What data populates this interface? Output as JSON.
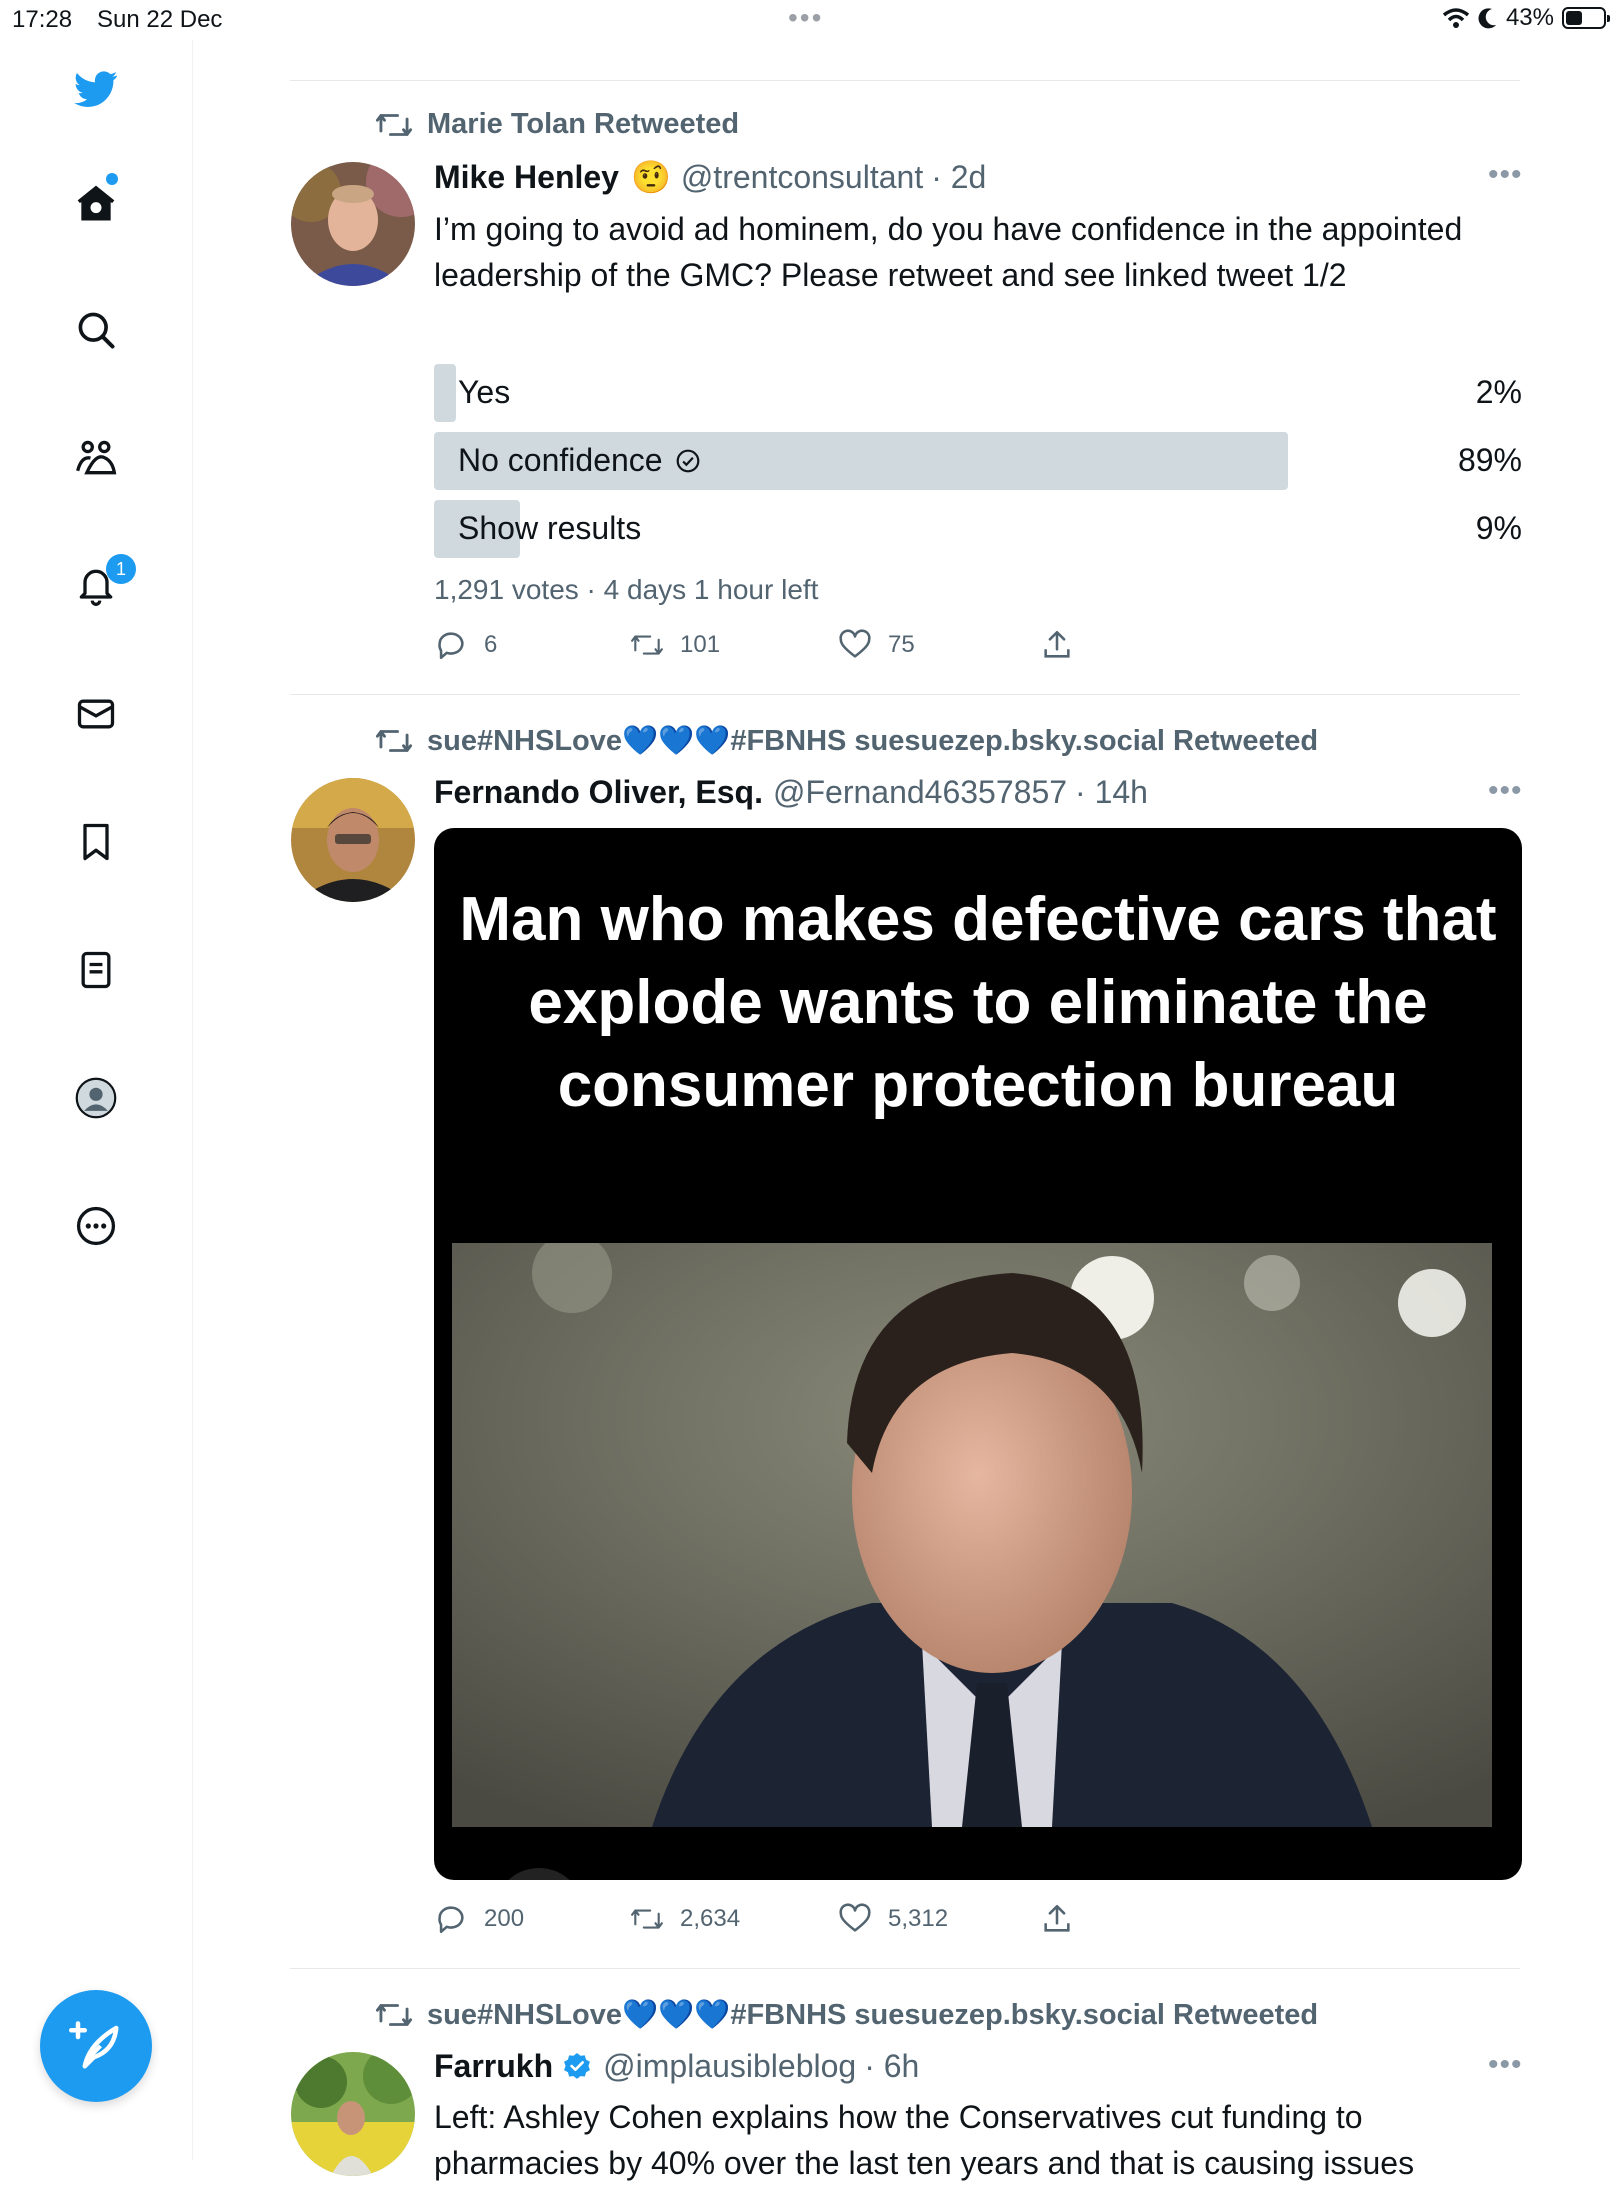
{
  "status_bar": {
    "time": "17:28",
    "date": "Sun 22 Dec",
    "battery": "43%",
    "more": "•••"
  },
  "sidebar": {
    "notifications_badge": "1"
  },
  "tweets": [
    {
      "retweeted_by": "Marie Tolan Retweeted",
      "name": "Mike Henley",
      "emoji": "🤨",
      "handle": "@trentconsultant",
      "time": "· 2d",
      "text": "I’m going to avoid ad hominem, do you have confidence in the appointed leadership of the GMC? Please retweet and see linked tweet 1/2",
      "poll": [
        {
          "label": "Yes",
          "percent": "2%",
          "fraction": 0.02
        },
        {
          "label": "No confidence",
          "percent": "89%",
          "fraction": 0.89,
          "winner": true
        },
        {
          "label": "Show results",
          "percent": "9%",
          "fraction": 0.09
        }
      ],
      "poll_meta": "1,291 votes · 4 days 1 hour left",
      "replies": "6",
      "retweets": "101",
      "likes": "75"
    },
    {
      "retweeted_by": "sue#NHSLove💙💙💙#FBNHS suesuezep.bsky.social Retweeted",
      "name": "Fernando Oliver, Esq.",
      "handle": "@Fernand46357857",
      "time": "· 14h",
      "image_caption": "Man who makes defective cars that explode wants to eliminate the consumer protection bureau",
      "replies": "200",
      "retweets": "2,634",
      "likes": "5,312"
    },
    {
      "retweeted_by": "sue#NHSLove💙💙💙#FBNHS suesuezep.bsky.social Retweeted",
      "name": "Farrukh",
      "handle": "@implausibleblog",
      "time": "· 6h",
      "text": "Left: Ashley Cohen explains how the Conservatives cut funding to pharmacies by 40% over the last ten years and that is causing issues"
    }
  ],
  "colors": {
    "accent": "#1d9bf0",
    "muted": "#536471",
    "poll_bar": "#cfd9de"
  }
}
